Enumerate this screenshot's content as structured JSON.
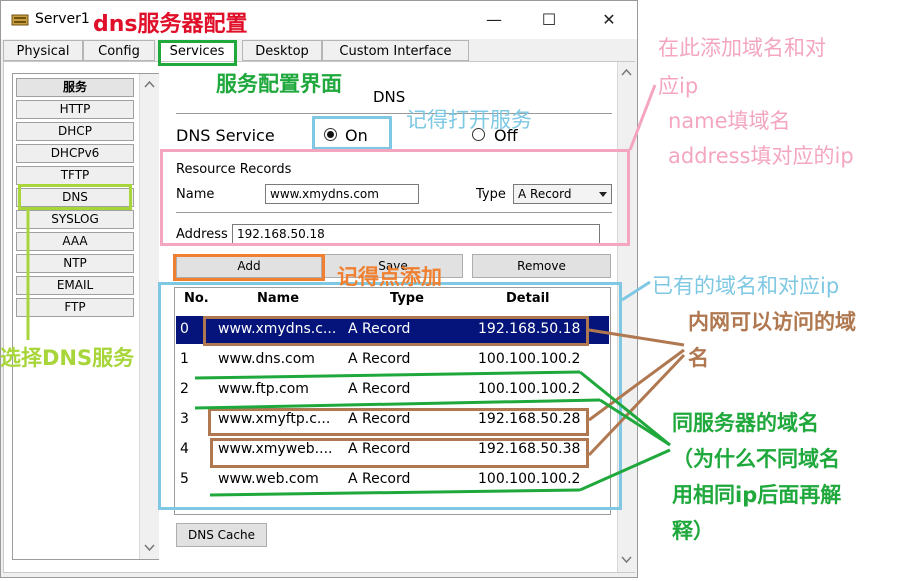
{
  "window": {
    "title": "Server1",
    "minimize_glyph": "—",
    "maximize_glyph": "☐",
    "close_glyph": "✕",
    "icon": "server-icon"
  },
  "tabs": [
    {
      "label": "Physical"
    },
    {
      "label": "Config"
    },
    {
      "label": "Services",
      "active": true
    },
    {
      "label": "Desktop"
    },
    {
      "label": "Custom Interface"
    }
  ],
  "sidebar": {
    "items": [
      "服务",
      "HTTP",
      "DHCP",
      "DHCPv6",
      "TFTP",
      "DNS",
      "SYSLOG",
      "AAA",
      "NTP",
      "EMAIL",
      "FTP"
    ],
    "selected": "DNS"
  },
  "dns_panel": {
    "title": "DNS",
    "service_label": "DNS Service",
    "on_label": "On",
    "off_label": "Off",
    "service_state": "On",
    "resource_records_label": "Resource Records",
    "name_label": "Name",
    "name_value": "www.xmydns.com",
    "type_label": "Type",
    "type_value": "A Record",
    "address_label": "Address",
    "address_value": "192.168.50.18",
    "add_label": "Add",
    "save_label": "Save",
    "remove_label": "Remove",
    "cache_label": "DNS Cache"
  },
  "records": {
    "headers": [
      "No.",
      "Name",
      "Type",
      "Detail"
    ],
    "rows": [
      {
        "no": "0",
        "name": "www.xmydns.c...",
        "type": "A Record",
        "detail": "192.168.50.18",
        "selected": true
      },
      {
        "no": "1",
        "name": "www.dns.com",
        "type": "A Record",
        "detail": "100.100.100.2"
      },
      {
        "no": "2",
        "name": "www.ftp.com",
        "type": "A Record",
        "detail": "100.100.100.2"
      },
      {
        "no": "3",
        "name": "www.xmyftp.c...",
        "type": "A Record",
        "detail": "192.168.50.28"
      },
      {
        "no": "4",
        "name": "www.xmyweb....",
        "type": "A Record",
        "detail": "192.168.50.38"
      },
      {
        "no": "5",
        "name": "www.web.com",
        "type": "A Record",
        "detail": "100.100.100.2"
      }
    ]
  },
  "annotations": {
    "dns_config": "dns服务器配置",
    "service_ui": "服务配置界面",
    "remember_enable": "记得打开服务",
    "add_domain_line1": "在此添加域名和对",
    "add_domain_line2": "应ip",
    "name_hint": "name填域名",
    "address_hint": "address填对应的ip",
    "remember_add": "记得点添加",
    "existing": "已有的域名和对应ip",
    "intranet_line1": "内网可以访问的域",
    "intranet_line2": "名",
    "select_dns": "选择DNS服务",
    "same_server_line1": "同服务器的域名",
    "same_server_line2": "（为什么不同域名",
    "same_server_line3": "用相同ip后面再解",
    "same_server_line4": "释）"
  },
  "colors": {
    "red": "#e0102a",
    "green": "#1fa83c",
    "light_blue": "#7ec8e3",
    "pink": "#f4a6c0",
    "orange": "#f08030",
    "brown": "#b07850",
    "lime": "#a8d63a",
    "selection": "#04147a"
  }
}
